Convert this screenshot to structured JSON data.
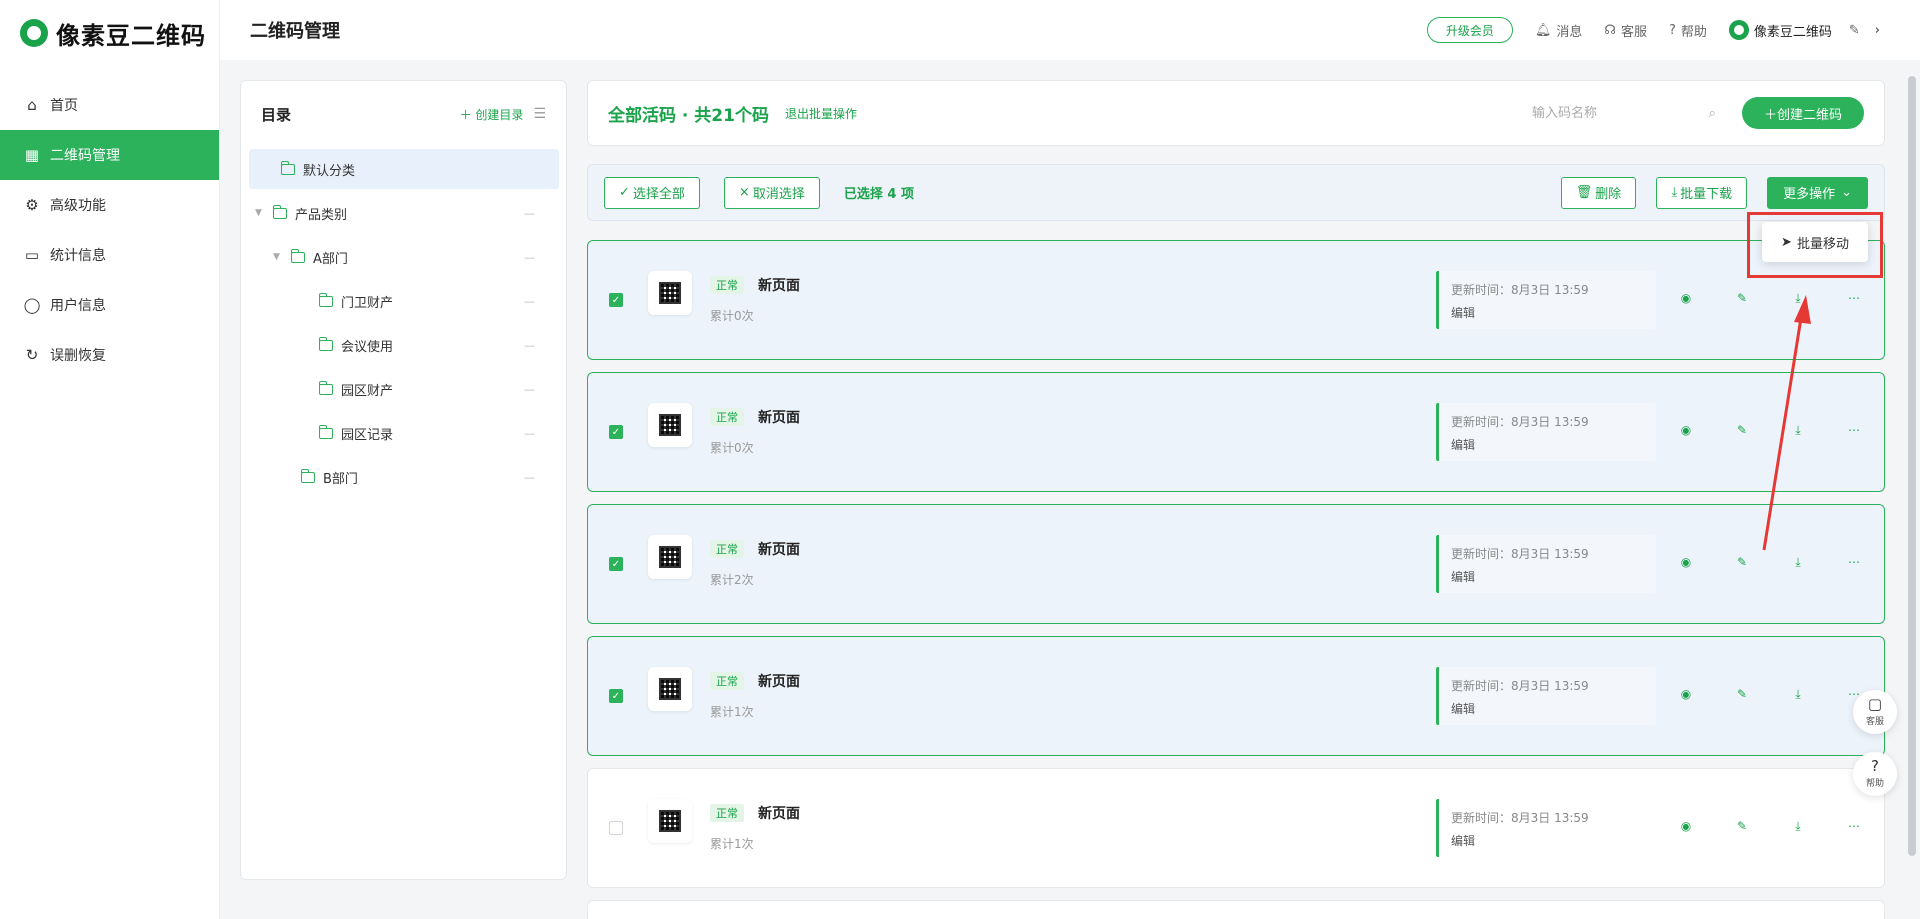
{
  "brand": {
    "name": "像素豆二维码"
  },
  "sidebar": {
    "items": [
      {
        "label": "首页",
        "icon": "home-icon",
        "glyph": "⌂"
      },
      {
        "label": "二维码管理",
        "icon": "grid-icon",
        "glyph": "▦"
      },
      {
        "label": "高级功能",
        "icon": "gear-icon",
        "glyph": "⚙"
      },
      {
        "label": "统计信息",
        "icon": "chart-board-icon",
        "glyph": "▭"
      },
      {
        "label": "用户信息",
        "icon": "user-icon",
        "glyph": "◯"
      },
      {
        "label": "误删恢复",
        "icon": "restore-icon",
        "glyph": "↻"
      }
    ]
  },
  "header": {
    "title": "二维码管理",
    "upgrade": "升级会员",
    "messages": "消息",
    "service": "客服",
    "help": "帮助",
    "user": "像素豆二维码"
  },
  "directory": {
    "title": "目录",
    "create": "创建目录",
    "items": [
      {
        "label": "默认分类",
        "selected": true
      },
      {
        "label": "产品类别"
      },
      {
        "label": "A部门"
      },
      {
        "label": "门卫财产"
      },
      {
        "label": "会议使用"
      },
      {
        "label": "园区财产"
      },
      {
        "label": "园区记录"
      },
      {
        "label": "B部门"
      }
    ]
  },
  "main": {
    "title": "全部活码 · 共21个码",
    "exit_batch": "退出批量操作",
    "search_placeholder": "输入码名称",
    "create_button": "创建二维码"
  },
  "batch": {
    "select_all": "选择全部",
    "cancel_select": "取消选择",
    "selected_count": "已选择 4 项",
    "delete": "删除",
    "batch_download": "批量下载",
    "more_ops": "更多操作",
    "dropdown_item": "批量移动"
  },
  "cards": [
    {
      "status": "正常",
      "name": "新页面",
      "count": "累计0次",
      "update_time": "更新时间：8月3日 13:59",
      "edit": "编辑",
      "checked": true
    },
    {
      "status": "正常",
      "name": "新页面",
      "count": "累计0次",
      "update_time": "更新时间：8月3日 13:59",
      "edit": "编辑",
      "checked": true
    },
    {
      "status": "正常",
      "name": "新页面",
      "count": "累计2次",
      "update_time": "更新时间：8月3日 13:59",
      "edit": "编辑",
      "checked": true
    },
    {
      "status": "正常",
      "name": "新页面",
      "count": "累计1次",
      "update_time": "更新时间：8月3日 13:59",
      "edit": "编辑",
      "checked": true
    },
    {
      "status": "正常",
      "name": "新页面",
      "count": "累计1次",
      "update_time": "更新时间：8月3日 13:59",
      "edit": "编辑",
      "checked": false
    }
  ],
  "floating": {
    "service": "客服",
    "help": "帮助"
  },
  "colors": {
    "accent": "#2bb25b",
    "highlight": "#e53935",
    "selected_bg": "#edf3fb"
  }
}
